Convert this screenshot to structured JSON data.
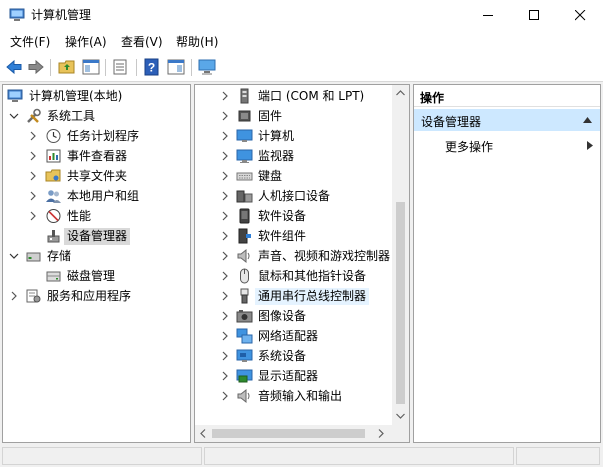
{
  "window": {
    "title": "计算机管理"
  },
  "menubar": {
    "items": [
      {
        "label": "文件(F)"
      },
      {
        "label": "操作(A)"
      },
      {
        "label": "查看(V)"
      },
      {
        "label": "帮助(H)"
      }
    ]
  },
  "left_tree": {
    "root": "计算机管理(本地)",
    "system_tools": "系统工具",
    "tools": [
      {
        "label": "任务计划程序"
      },
      {
        "label": "事件查看器"
      },
      {
        "label": "共享文件夹"
      },
      {
        "label": "本地用户和组"
      },
      {
        "label": "性能"
      },
      {
        "label": "设备管理器"
      }
    ],
    "storage": "存储",
    "disk_management": "磁盘管理",
    "services": "服务和应用程序"
  },
  "devices": {
    "items": [
      {
        "label": "端口 (COM 和 LPT)"
      },
      {
        "label": "固件"
      },
      {
        "label": "计算机"
      },
      {
        "label": "监视器"
      },
      {
        "label": "键盘"
      },
      {
        "label": "人机接口设备"
      },
      {
        "label": "软件设备"
      },
      {
        "label": "软件组件"
      },
      {
        "label": "声音、视频和游戏控制器"
      },
      {
        "label": "鼠标和其他指针设备"
      },
      {
        "label": "通用串行总线控制器"
      },
      {
        "label": "图像设备"
      },
      {
        "label": "网络适配器"
      },
      {
        "label": "系统设备"
      },
      {
        "label": "显示适配器"
      },
      {
        "label": "音频输入和输出"
      }
    ]
  },
  "actions": {
    "header": "操作",
    "section": "设备管理器",
    "more": "更多操作"
  },
  "colors": {
    "selection": "#d9d9d9",
    "hover": "#e5f3ff",
    "action_section": "#cde8ff",
    "accent_blue": "#1e78d2"
  }
}
